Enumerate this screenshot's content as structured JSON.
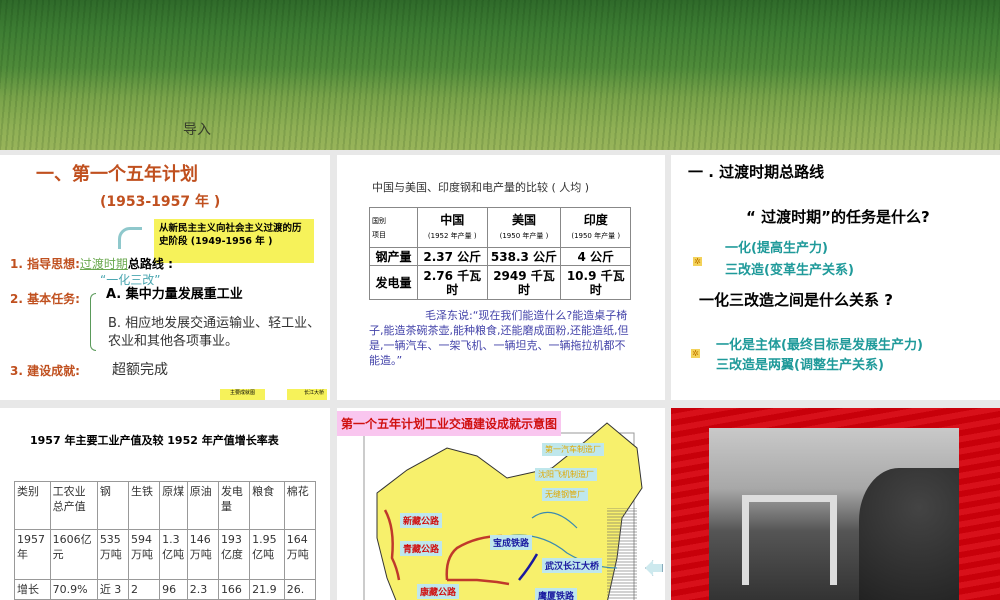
{
  "slide_intro": {
    "label": "导入"
  },
  "slide_plan": {
    "title": "一、第一个五年计划",
    "years": "(1953-1957 年 )",
    "callout": "从新民主主义向社会主义过渡的历史阶段 (1949-1956 年 )",
    "item1_label": "1. 指导思想:",
    "item1_link": "过渡时期",
    "item1_rest": "总路线 :",
    "item1_sub": "“一化三改”",
    "item2_label": "2. 基本任务:",
    "item2_a": "A. 集中力量发展重工业",
    "item2_b": "B. 相应地发展交通运输业、轻工业、农业和其他各项事业。",
    "item3_label": "3. 建设成就:",
    "item3_value": "超额完成",
    "btn1": "主要成就图",
    "btn2": "长江大桥"
  },
  "slide_compare": {
    "title": "中国与美国、印度钢和电产量的比较 ( 人均 )",
    "corner_top": "国别",
    "corner_bottom": "项目",
    "columns": [
      {
        "name": "中国",
        "note": "(1952 年产量 )"
      },
      {
        "name": "美国",
        "note": "(1950 年产量 )"
      },
      {
        "name": "印度",
        "note": "(1950 年产量 )"
      }
    ],
    "rows": [
      {
        "label": "钢产量",
        "values": [
          "2.37 公斤",
          "538.3 公斤",
          "4 公斤"
        ]
      },
      {
        "label": "发电量",
        "values": [
          "2.76 千瓦时",
          "2949 千瓦时",
          "10.9 千瓦时"
        ]
      }
    ],
    "quote": "毛泽东说:“现在我们能造什么?能造桌子椅子,能造茶碗茶壶,能种粮食,还能磨成面粉,还能造纸,但是,一辆汽车、一架飞机、一辆坦克、一辆拖拉机都不能造。”"
  },
  "slide_line": {
    "title": "一 . 过渡时期总路线",
    "question1": "“ 过渡时期”的任务是什么?",
    "answer1a": "一化(提高生产力)",
    "answer1b": "三改造(变革生产关系)",
    "question2": "一化三改造之间是什么关系 ?",
    "answer2a": "一化是主体(最终目标是发展生产力)",
    "answer2b": "三改造是两翼(调整生产关系)"
  },
  "slide_table": {
    "title": "1957 年主要工业产值及较 1952 年产值增长率表",
    "headers": [
      "类别",
      "工农业总产值",
      "钢",
      "生铁",
      "原煤",
      "原油",
      "发电量",
      "粮食",
      "棉花"
    ],
    "rows": [
      [
        "1957年",
        "1606亿元",
        "535万吨",
        "594万吨",
        "1.3亿吨",
        "146万吨",
        "193亿度",
        "1.95亿吨",
        "164万吨"
      ],
      [
        "增长",
        "70.9%",
        "近 3",
        "2",
        "96",
        "2.3",
        "166",
        "21.9",
        "26."
      ]
    ]
  },
  "slide_map": {
    "title": "第一个五年计划工业交通建设成就示意图",
    "labels": {
      "auto": "第一汽车制造厂",
      "plane": "沈阳飞机制造厂",
      "pipe": "无缝钢管厂",
      "xinzang": "新藏公路",
      "qingzang": "青藏公路",
      "kangzang": "康藏公路",
      "baocheng": "宝成铁路",
      "wuhan": "武汉长江大桥",
      "yingxia": "鹰厦铁路"
    }
  },
  "slide_photo": {}
}
